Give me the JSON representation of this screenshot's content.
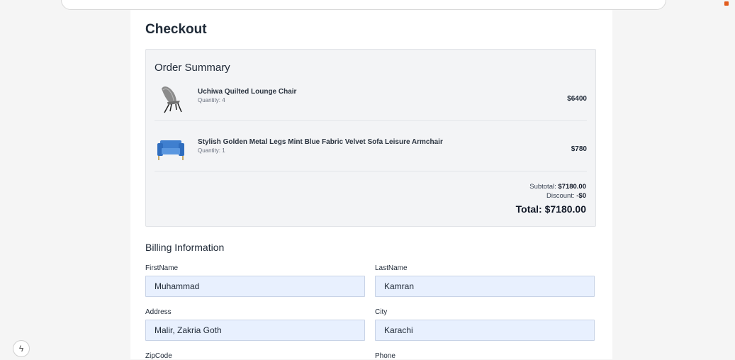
{
  "page": {
    "title": "Checkout"
  },
  "summary": {
    "title": "Order Summary",
    "items": [
      {
        "name": "Uchiwa Quilted Lounge Chair",
        "quantity": "Quantity: 4",
        "price": "$6400",
        "icon": "lounge-chair-icon"
      },
      {
        "name": "Stylish Golden Metal Legs Mint Blue Fabric Velvet Sofa Leisure Armchair",
        "quantity": "Quantity: 1",
        "price": "$780",
        "icon": "blue-armchair-icon"
      }
    ],
    "subtotal_label": "Subtotal:",
    "subtotal_value": "$7180.00",
    "discount_label": "Discount:",
    "discount_value": "-$0",
    "total_label": "Total:",
    "total_value": "$7180.00"
  },
  "billing": {
    "title": "Billing Information",
    "first_name_label": "FirstName",
    "first_name_value": "Muhammad",
    "last_name_label": "LastName",
    "last_name_value": "Kamran",
    "address_label": "Address",
    "address_value": "Malir, Zakria Goth",
    "city_label": "City",
    "city_value": "Karachi",
    "zip_label": "ZipCode",
    "phone_label": "Phone"
  },
  "floating": {
    "icon": "lightning-icon",
    "glyph": "ϟ"
  }
}
